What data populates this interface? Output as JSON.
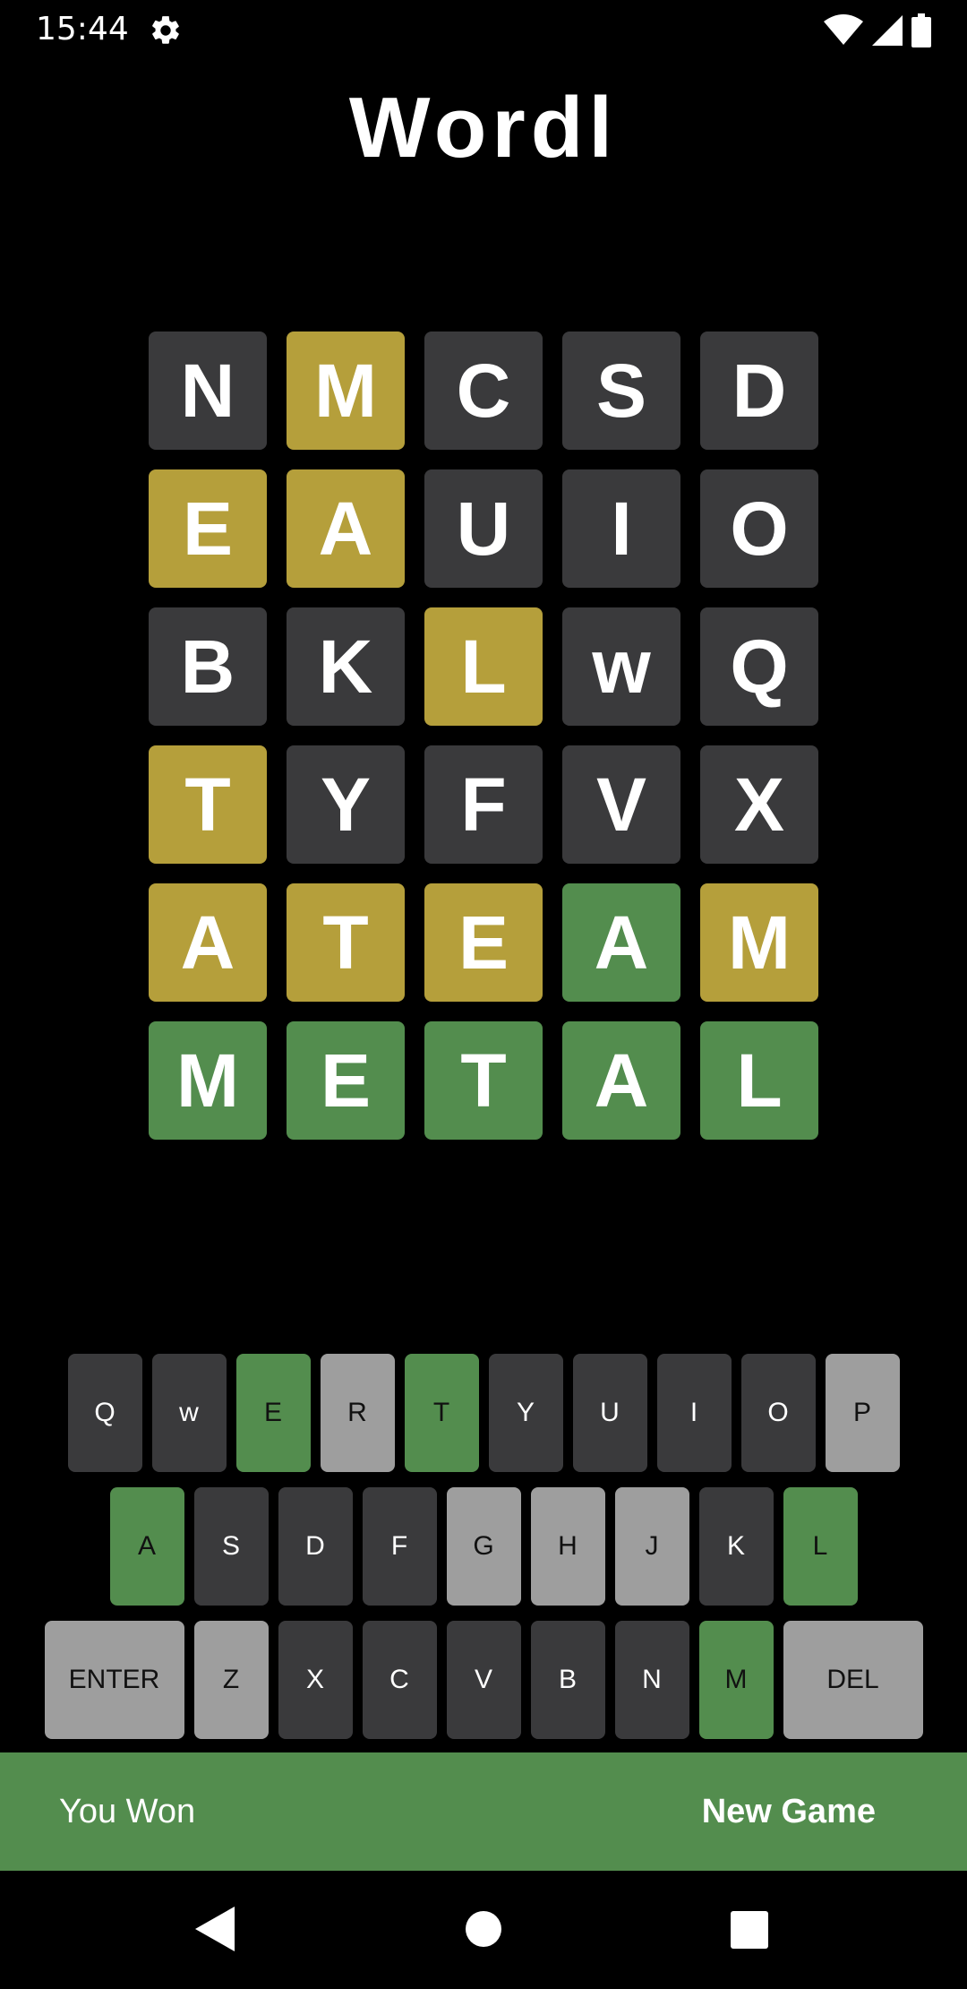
{
  "status_bar": {
    "time": "15:44",
    "icons": [
      "gear-icon",
      "wifi-icon",
      "signal-icon",
      "battery-icon"
    ]
  },
  "app": {
    "title": "Wordl"
  },
  "colors": {
    "background": "#000000",
    "absent": "#3a3a3c",
    "present": "#b59f3b",
    "correct": "#538d4e",
    "unused_key": "#9e9e9e",
    "text": "#ffffff"
  },
  "board": [
    [
      {
        "letter": "N",
        "state": "absent"
      },
      {
        "letter": "M",
        "state": "present"
      },
      {
        "letter": "C",
        "state": "absent"
      },
      {
        "letter": "S",
        "state": "absent"
      },
      {
        "letter": "D",
        "state": "absent"
      }
    ],
    [
      {
        "letter": "E",
        "state": "present"
      },
      {
        "letter": "A",
        "state": "present"
      },
      {
        "letter": "U",
        "state": "absent"
      },
      {
        "letter": "I",
        "state": "absent"
      },
      {
        "letter": "O",
        "state": "absent"
      }
    ],
    [
      {
        "letter": "B",
        "state": "absent"
      },
      {
        "letter": "K",
        "state": "absent"
      },
      {
        "letter": "L",
        "state": "present"
      },
      {
        "letter": "w",
        "state": "absent"
      },
      {
        "letter": "Q",
        "state": "absent"
      }
    ],
    [
      {
        "letter": "T",
        "state": "present"
      },
      {
        "letter": "Y",
        "state": "absent"
      },
      {
        "letter": "F",
        "state": "absent"
      },
      {
        "letter": "V",
        "state": "absent"
      },
      {
        "letter": "X",
        "state": "absent"
      }
    ],
    [
      {
        "letter": "A",
        "state": "present"
      },
      {
        "letter": "T",
        "state": "present"
      },
      {
        "letter": "E",
        "state": "present"
      },
      {
        "letter": "A",
        "state": "correct"
      },
      {
        "letter": "M",
        "state": "present"
      }
    ],
    [
      {
        "letter": "M",
        "state": "correct"
      },
      {
        "letter": "E",
        "state": "correct"
      },
      {
        "letter": "T",
        "state": "correct"
      },
      {
        "letter": "A",
        "state": "correct"
      },
      {
        "letter": "L",
        "state": "correct"
      }
    ]
  ],
  "keyboard": [
    [
      {
        "label": "Q",
        "state": "absent"
      },
      {
        "label": "w",
        "state": "absent"
      },
      {
        "label": "E",
        "state": "correct"
      },
      {
        "label": "R",
        "state": "unused"
      },
      {
        "label": "T",
        "state": "correct"
      },
      {
        "label": "Y",
        "state": "absent"
      },
      {
        "label": "U",
        "state": "absent"
      },
      {
        "label": "I",
        "state": "absent"
      },
      {
        "label": "O",
        "state": "absent"
      },
      {
        "label": "P",
        "state": "unused"
      }
    ],
    [
      {
        "label": "A",
        "state": "correct"
      },
      {
        "label": "S",
        "state": "absent"
      },
      {
        "label": "D",
        "state": "absent"
      },
      {
        "label": "F",
        "state": "absent"
      },
      {
        "label": "G",
        "state": "unused"
      },
      {
        "label": "H",
        "state": "unused"
      },
      {
        "label": "J",
        "state": "unused"
      },
      {
        "label": "K",
        "state": "absent"
      },
      {
        "label": "L",
        "state": "correct"
      }
    ],
    [
      {
        "label": "ENTER",
        "state": "unused",
        "wide": true
      },
      {
        "label": "Z",
        "state": "unused"
      },
      {
        "label": "X",
        "state": "absent"
      },
      {
        "label": "C",
        "state": "absent"
      },
      {
        "label": "V",
        "state": "absent"
      },
      {
        "label": "B",
        "state": "absent"
      },
      {
        "label": "N",
        "state": "absent"
      },
      {
        "label": "M",
        "state": "correct"
      },
      {
        "label": "DEL",
        "state": "unused",
        "wide": true
      }
    ]
  ],
  "result": {
    "message": "You Won",
    "new_game_label": "New Game"
  },
  "nav_bar": {
    "icons": [
      "back-icon",
      "home-icon",
      "recents-icon"
    ]
  }
}
